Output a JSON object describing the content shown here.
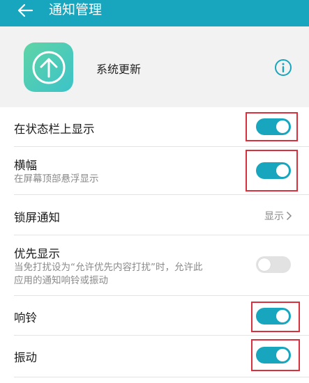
{
  "header": {
    "title": "通知管理",
    "back_icon": "arrow-left-icon"
  },
  "app": {
    "name": "系统更新",
    "icon": "arrow-up-circle-icon",
    "info_icon": "info-icon"
  },
  "settings": [
    {
      "title": "在状态栏上显示",
      "toggle": true
    },
    {
      "title": "横幅",
      "subtitle": "在屏幕顶部悬浮显示",
      "toggle": true
    },
    {
      "title": "锁屏通知",
      "value": "显示"
    },
    {
      "title": "优先显示",
      "subtitle_line1": "当免打扰设为“允许优先内容打扰”时，允许此",
      "subtitle_line2": "应用的通知响铃或振动",
      "toggle": false
    },
    {
      "title": "响铃",
      "toggle": true
    },
    {
      "title": "振动",
      "toggle": true
    }
  ],
  "colors": {
    "accent": "#17a6bd",
    "highlight": "#d8313d",
    "toggle_off": "#e2e2e2"
  }
}
